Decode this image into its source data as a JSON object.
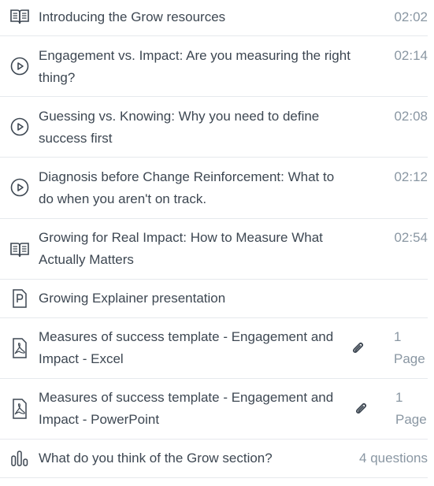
{
  "items": [
    {
      "type": "reading",
      "icon": "book-icon",
      "title": "Introducing the Grow resources",
      "meta": "02:02"
    },
    {
      "type": "video",
      "icon": "play-circle-icon",
      "title_line1": "Engagement vs. Impact: Are you measuring the right",
      "title_line2": "thing?",
      "meta": "02:14"
    },
    {
      "type": "video",
      "icon": "play-circle-icon",
      "title_line1": "Guessing vs. Knowing: Why you need to define",
      "title_line2": "success first",
      "meta": "02:08"
    },
    {
      "type": "video",
      "icon": "play-circle-icon",
      "title_line1": "Diagnosis before Change Reinforcement: What to",
      "title_line2": "do when you aren't on track.",
      "meta": "02:12"
    },
    {
      "type": "reading",
      "icon": "book-icon",
      "title_line1": "Growing for Real Impact: How to Measure What",
      "title_line2": "Actually Matters",
      "meta": "02:54"
    },
    {
      "type": "presentation",
      "icon": "presentation-p-icon",
      "title": "Growing Explainer presentation"
    },
    {
      "type": "pdf",
      "icon": "pdf-icon",
      "title_line1": "Measures of success template - Engagement and",
      "title_line2": "Impact - Excel",
      "attachment_icon": "paperclip-icon",
      "meta_line1": "1",
      "meta_line2": "Page"
    },
    {
      "type": "pdf",
      "icon": "pdf-icon",
      "title_line1": "Measures of success template - Engagement and",
      "title_line2": "Impact - PowerPoint",
      "attachment_icon": "paperclip-icon",
      "meta_line1": "1",
      "meta_line2": "Page"
    },
    {
      "type": "survey",
      "icon": "bar-chart-icon",
      "title": "What do you think of the Grow section?",
      "meta": "4 questions"
    }
  ]
}
